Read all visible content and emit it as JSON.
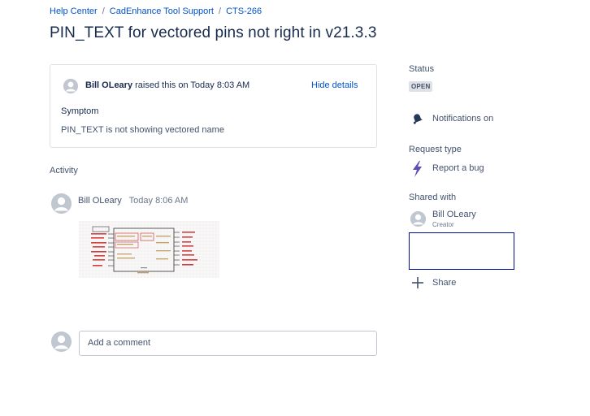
{
  "breadcrumb": {
    "items": [
      "Help Center",
      "CadEnhance Tool Support",
      "CTS-266"
    ],
    "separator": "/"
  },
  "page_title": "PIN_TEXT for vectored pins not right in v21.3.3",
  "request": {
    "author": "Bill OLeary",
    "raised_text": "raised this on Today 8:03 AM",
    "hide_details": "Hide details",
    "symptom_label": "Symptom",
    "symptom_value": "PIN_TEXT is not showing vectored name"
  },
  "activity": {
    "heading": "Activity",
    "comments": [
      {
        "author": "Bill OLeary",
        "time": "Today 8:06 AM",
        "attachment_icon": "schematic-thumbnail"
      }
    ]
  },
  "comment_input": {
    "placeholder": "Add a comment"
  },
  "sidebar": {
    "status_label": "Status",
    "status_value": "OPEN",
    "notifications": "Notifications on",
    "request_type_label": "Request type",
    "request_type_value": "Report a bug",
    "shared_with_label": "Shared with",
    "shared_user": "Bill OLeary",
    "shared_user_role": "Creator",
    "share_label": "Share"
  },
  "colors": {
    "link": "#0052cc",
    "text": "#172b4d",
    "subtle_text": "#42526e",
    "lozenge_bg": "#dfe1e6",
    "bolt": "#5e4db2",
    "focus_border": "#000d9a"
  }
}
